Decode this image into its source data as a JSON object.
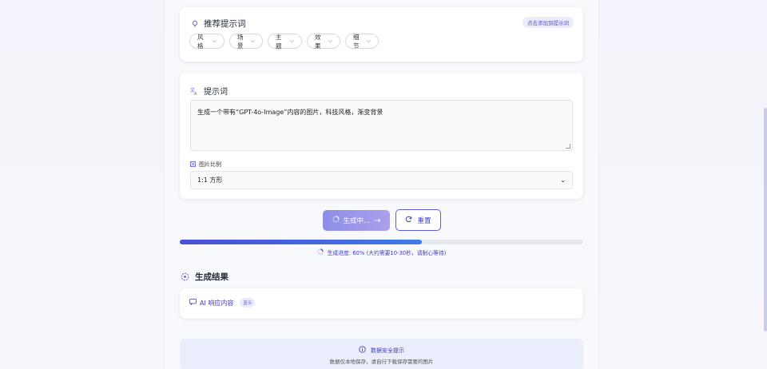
{
  "recommend": {
    "title": "推荐提示词",
    "hint": "点击添加到提示词",
    "chips": [
      {
        "label": "风格"
      },
      {
        "label": "场景"
      },
      {
        "label": "主题"
      },
      {
        "label": "效果"
      },
      {
        "label": "细节"
      }
    ]
  },
  "prompt": {
    "title": "提示词",
    "value": "生成一个带有“GPT-4o-Image”内容的图片，科技风格，渐变背景",
    "ratio_label": "图片比例",
    "ratio_selected": "1:1 方形"
  },
  "actions": {
    "generate_label": "生成中...",
    "reset_label": "重置"
  },
  "progress": {
    "percent": 60,
    "text": "生成进度: 60% (大约需要10-30秒，请耐心等待)"
  },
  "result": {
    "title": "生成结果",
    "ai_label": "AI 响应内容",
    "ai_badge": "显示"
  },
  "security": {
    "title": "数据安全提示",
    "subtitle": "数据仅本地保存，请自行下载保存需要的图片"
  },
  "colors": {
    "accent": "#5d5bd6",
    "progress": "#4c4fd6"
  }
}
